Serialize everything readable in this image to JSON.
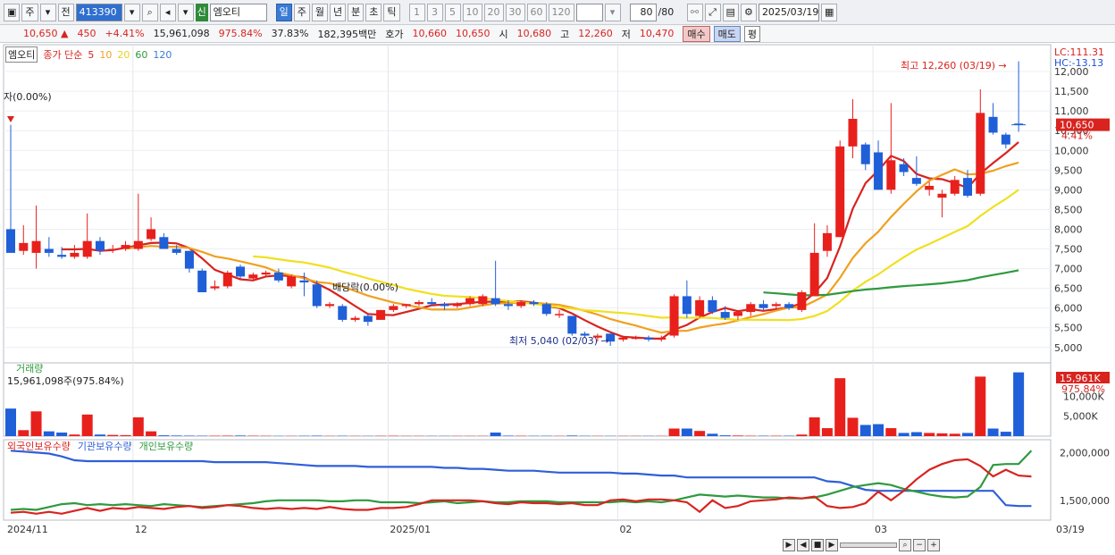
{
  "toolbar": {
    "market": "주",
    "prev_label": "전",
    "stock_code": "413390",
    "new_badge": "신",
    "stock_name": "엠오티",
    "periods": [
      "일",
      "주",
      "월",
      "년",
      "분",
      "초",
      "틱"
    ],
    "active_period": "일",
    "intervals": [
      "1",
      "3",
      "5",
      "10",
      "20",
      "30",
      "60",
      "120"
    ],
    "count_value": "80",
    "count_total": "/80",
    "date_value": "2025/03/19"
  },
  "infobar": {
    "price": "10,650 ▲",
    "change": "450",
    "change_pct": "+4.41%",
    "volume": "15,961,098",
    "volume_ratio": "975.84%",
    "turnover": "37.83%",
    "trade_value": "182,395백만",
    "ask_label": "호가",
    "ask_price": "10,660",
    "bid_price": "10,650",
    "open_label": "시",
    "open_price": "10,680",
    "high_label": "고",
    "high_price": "12,260",
    "low_label": "저",
    "low_price": "10,470",
    "buy_label": "매수",
    "sell_label": "매도",
    "avg_label": "평"
  },
  "legend": {
    "name": "엠오티",
    "series_prefix": "종가 단순",
    "ma_labels": [
      "5",
      "10",
      "20",
      "60",
      "120"
    ],
    "ma_colors": [
      "#d8231f",
      "#f0a020",
      "#f0e020",
      "#2e9a3e",
      "#3a7bd5"
    ]
  },
  "annotations": {
    "ex_right": "자(0.00%)",
    "dividend_drop": "배당락(0.00%)",
    "high_note": "최고 12,260 (03/19) →",
    "low_note": "최저 5,040 (02/03) →",
    "lc": "LC:111.31",
    "hc": "HC:-13.13",
    "current_price_tag": "10,650",
    "current_pct_tag": "4.41%"
  },
  "volume_panel": {
    "title": "거래량",
    "value_label": "15,961,098주(975.84%)",
    "tag_value": "15,961K",
    "tag_pct": "975.84%"
  },
  "holding_panel": {
    "labels": [
      "외국인보유수량",
      "기관보유수량",
      "개인보유수량"
    ],
    "colors": [
      "#d8231f",
      "#2f5fd8",
      "#2e9a3e"
    ]
  },
  "axis": {
    "price_ticks": [
      "12,000",
      "11,500",
      "11,000",
      "10,500",
      "10,000",
      "9,500",
      "9,000",
      "8,500",
      "8,000",
      "7,500",
      "7,000",
      "6,500",
      "6,000",
      "5,500",
      "5,000"
    ],
    "volume_ticks": [
      "10,000K",
      "5,000K"
    ],
    "holding_ticks": [
      "2,000,000",
      "1,500,000"
    ],
    "date_labels": [
      "2024/11",
      "12",
      "2025/01",
      "02",
      "03",
      "03/19"
    ]
  },
  "chart_data": {
    "type": "candlestick",
    "price_range": [
      4700,
      12500
    ],
    "candles": [
      {
        "o": 8000,
        "h": 10650,
        "l": 7400,
        "c": 7400
      },
      {
        "o": 7450,
        "h": 8100,
        "l": 7350,
        "c": 7650
      },
      {
        "o": 7400,
        "h": 8600,
        "l": 7000,
        "c": 7700
      },
      {
        "o": 7500,
        "h": 7800,
        "l": 7300,
        "c": 7400
      },
      {
        "o": 7350,
        "h": 7550,
        "l": 7250,
        "c": 7300
      },
      {
        "o": 7300,
        "h": 7600,
        "l": 7250,
        "c": 7400
      },
      {
        "o": 7300,
        "h": 8400,
        "l": 7250,
        "c": 7700
      },
      {
        "o": 7700,
        "h": 7800,
        "l": 7350,
        "c": 7450
      },
      {
        "o": 7500,
        "h": 7600,
        "l": 7400,
        "c": 7500
      },
      {
        "o": 7500,
        "h": 7700,
        "l": 7450,
        "c": 7600
      },
      {
        "o": 7500,
        "h": 8900,
        "l": 7450,
        "c": 7700
      },
      {
        "o": 7750,
        "h": 8300,
        "l": 7700,
        "c": 8000
      },
      {
        "o": 7800,
        "h": 7900,
        "l": 7500,
        "c": 7500
      },
      {
        "o": 7500,
        "h": 7600,
        "l": 7350,
        "c": 7400
      },
      {
        "o": 7450,
        "h": 7450,
        "l": 6900,
        "c": 7000
      },
      {
        "o": 6950,
        "h": 7000,
        "l": 6400,
        "c": 6400
      },
      {
        "o": 6500,
        "h": 6700,
        "l": 6450,
        "c": 6550
      },
      {
        "o": 6550,
        "h": 6950,
        "l": 6500,
        "c": 6900
      },
      {
        "o": 7050,
        "h": 7100,
        "l": 6750,
        "c": 6800
      },
      {
        "o": 6750,
        "h": 6900,
        "l": 6700,
        "c": 6850
      },
      {
        "o": 6850,
        "h": 6950,
        "l": 6800,
        "c": 6900
      },
      {
        "o": 6900,
        "h": 7000,
        "l": 6650,
        "c": 6700
      },
      {
        "o": 6550,
        "h": 6850,
        "l": 6500,
        "c": 6800
      },
      {
        "o": 6700,
        "h": 6900,
        "l": 6300,
        "c": 6650
      },
      {
        "o": 6600,
        "h": 6700,
        "l": 6000,
        "c": 6050
      },
      {
        "o": 6050,
        "h": 6150,
        "l": 6000,
        "c": 6100
      },
      {
        "o": 6050,
        "h": 6100,
        "l": 5650,
        "c": 5700
      },
      {
        "o": 5700,
        "h": 5800,
        "l": 5650,
        "c": 5750
      },
      {
        "o": 5800,
        "h": 5850,
        "l": 5550,
        "c": 5650
      },
      {
        "o": 5700,
        "h": 5950,
        "l": 5700,
        "c": 5950
      },
      {
        "o": 5950,
        "h": 6100,
        "l": 5900,
        "c": 6050
      },
      {
        "o": 6050,
        "h": 6100,
        "l": 6000,
        "c": 6100
      },
      {
        "o": 6100,
        "h": 6200,
        "l": 6050,
        "c": 6150
      },
      {
        "o": 6150,
        "h": 6250,
        "l": 6050,
        "c": 6100
      },
      {
        "o": 6100,
        "h": 6150,
        "l": 5950,
        "c": 6050
      },
      {
        "o": 6050,
        "h": 6150,
        "l": 6000,
        "c": 6100
      },
      {
        "o": 6100,
        "h": 6300,
        "l": 6050,
        "c": 6250
      },
      {
        "o": 6100,
        "h": 6350,
        "l": 6050,
        "c": 6300
      },
      {
        "o": 6250,
        "h": 7200,
        "l": 6050,
        "c": 6100
      },
      {
        "o": 6100,
        "h": 6200,
        "l": 5950,
        "c": 6050
      },
      {
        "o": 6050,
        "h": 6200,
        "l": 6000,
        "c": 6150
      },
      {
        "o": 6150,
        "h": 6200,
        "l": 6050,
        "c": 6100
      },
      {
        "o": 6100,
        "h": 6150,
        "l": 5800,
        "c": 5850
      },
      {
        "o": 5850,
        "h": 5950,
        "l": 5750,
        "c": 5850
      },
      {
        "o": 5800,
        "h": 5800,
        "l": 5300,
        "c": 5350
      },
      {
        "o": 5350,
        "h": 5400,
        "l": 5250,
        "c": 5300
      },
      {
        "o": 5250,
        "h": 5350,
        "l": 5150,
        "c": 5300
      },
      {
        "o": 5350,
        "h": 5350,
        "l": 5040,
        "c": 5150
      },
      {
        "o": 5200,
        "h": 5300,
        "l": 5150,
        "c": 5250
      },
      {
        "o": 5250,
        "h": 5300,
        "l": 5200,
        "c": 5250
      },
      {
        "o": 5250,
        "h": 5300,
        "l": 5150,
        "c": 5200
      },
      {
        "o": 5200,
        "h": 5300,
        "l": 5150,
        "c": 5250
      },
      {
        "o": 5300,
        "h": 6350,
        "l": 5250,
        "c": 6300
      },
      {
        "o": 6300,
        "h": 6700,
        "l": 5750,
        "c": 5850
      },
      {
        "o": 5800,
        "h": 6300,
        "l": 5750,
        "c": 6200
      },
      {
        "o": 6200,
        "h": 6300,
        "l": 5850,
        "c": 5900
      },
      {
        "o": 5900,
        "h": 6050,
        "l": 5700,
        "c": 5750
      },
      {
        "o": 5800,
        "h": 5950,
        "l": 5700,
        "c": 5900
      },
      {
        "o": 5900,
        "h": 6150,
        "l": 5800,
        "c": 6100
      },
      {
        "o": 6100,
        "h": 6200,
        "l": 5950,
        "c": 6000
      },
      {
        "o": 6050,
        "h": 6150,
        "l": 5950,
        "c": 6100
      },
      {
        "o": 6100,
        "h": 6150,
        "l": 5950,
        "c": 6000
      },
      {
        "o": 5950,
        "h": 6450,
        "l": 5900,
        "c": 6400
      },
      {
        "o": 6300,
        "h": 8150,
        "l": 6300,
        "c": 7400
      },
      {
        "o": 7450,
        "h": 8100,
        "l": 7300,
        "c": 7900
      },
      {
        "o": 7800,
        "h": 10250,
        "l": 7800,
        "c": 10100
      },
      {
        "o": 10100,
        "h": 11300,
        "l": 9800,
        "c": 10800
      },
      {
        "o": 10150,
        "h": 10200,
        "l": 9500,
        "c": 9650
      },
      {
        "o": 9950,
        "h": 10250,
        "l": 9000,
        "c": 9000
      },
      {
        "o": 9000,
        "h": 11200,
        "l": 8900,
        "c": 9750
      },
      {
        "o": 9650,
        "h": 9800,
        "l": 9350,
        "c": 9450
      },
      {
        "o": 9300,
        "h": 9850,
        "l": 9100,
        "c": 9150
      },
      {
        "o": 9000,
        "h": 9200,
        "l": 8850,
        "c": 9100
      },
      {
        "o": 8800,
        "h": 9000,
        "l": 8300,
        "c": 8900
      },
      {
        "o": 8900,
        "h": 9350,
        "l": 8850,
        "c": 9250
      },
      {
        "o": 9300,
        "h": 9500,
        "l": 8800,
        "c": 8850
      },
      {
        "o": 8900,
        "h": 11550,
        "l": 8850,
        "c": 10950
      },
      {
        "o": 10850,
        "h": 11200,
        "l": 10400,
        "c": 10450
      },
      {
        "o": 10400,
        "h": 10450,
        "l": 10050,
        "c": 10150
      },
      {
        "o": 10680,
        "h": 12260,
        "l": 10470,
        "c": 10650
      }
    ],
    "volume_k": [
      6900,
      1500,
      6200,
      1200,
      900,
      400,
      5400,
      400,
      300,
      250,
      4700,
      1200,
      200,
      150,
      120,
      100,
      100,
      120,
      150,
      100,
      80,
      60,
      60,
      90,
      120,
      60,
      90,
      60,
      60,
      80,
      90,
      60,
      60,
      60,
      60,
      60,
      60,
      60,
      900,
      120,
      90,
      80,
      80,
      60,
      150,
      80,
      60,
      60,
      60,
      60,
      60,
      60,
      1900,
      1900,
      1300,
      600,
      200,
      150,
      100,
      100,
      100,
      100,
      400,
      4700,
      2000,
      14500,
      4600,
      2800,
      3000,
      2000,
      800,
      1000,
      800,
      700,
      600,
      800,
      14900,
      1900,
      1100,
      15961
    ],
    "holding_foreign": [
      1370000,
      1380000,
      1360000,
      1380000,
      1360000,
      1390000,
      1420000,
      1390000,
      1420000,
      1410000,
      1430000,
      1420000,
      1410000,
      1430000,
      1440000,
      1420000,
      1430000,
      1450000,
      1440000,
      1420000,
      1410000,
      1420000,
      1410000,
      1420000,
      1410000,
      1430000,
      1410000,
      1400000,
      1400000,
      1420000,
      1420000,
      1430000,
      1460000,
      1500000,
      1500000,
      1500000,
      1500000,
      1490000,
      1470000,
      1460000,
      1480000,
      1470000,
      1470000,
      1460000,
      1470000,
      1450000,
      1450000,
      1500000,
      1510000,
      1490000,
      1510000,
      1510000,
      1500000,
      1480000,
      1380000,
      1500000,
      1420000,
      1440000,
      1490000,
      1500000,
      1510000,
      1530000,
      1520000,
      1540000,
      1440000,
      1420000,
      1430000,
      1470000,
      1590000,
      1500000,
      1600000,
      1720000,
      1820000,
      1880000,
      1920000,
      1930000,
      1860000,
      1750000,
      1820000,
      1760000,
      1750000
    ],
    "holding_inst": [
      2020000,
      2010000,
      2000000,
      1990000,
      1960000,
      1920000,
      1910000,
      1910000,
      1910000,
      1910000,
      1910000,
      1910000,
      1910000,
      1910000,
      1910000,
      1910000,
      1900000,
      1900000,
      1900000,
      1900000,
      1900000,
      1890000,
      1880000,
      1870000,
      1860000,
      1860000,
      1860000,
      1860000,
      1850000,
      1850000,
      1850000,
      1850000,
      1850000,
      1850000,
      1840000,
      1840000,
      1830000,
      1830000,
      1820000,
      1810000,
      1810000,
      1810000,
      1800000,
      1790000,
      1790000,
      1790000,
      1790000,
      1790000,
      1780000,
      1780000,
      1770000,
      1760000,
      1760000,
      1740000,
      1740000,
      1740000,
      1740000,
      1740000,
      1740000,
      1740000,
      1740000,
      1740000,
      1740000,
      1740000,
      1700000,
      1690000,
      1650000,
      1610000,
      1600000,
      1600000,
      1600000,
      1600000,
      1600000,
      1600000,
      1600000,
      1600000,
      1600000,
      1600000,
      1450000,
      1440000,
      1440000
    ],
    "holding_indiv": [
      1400000,
      1410000,
      1400000,
      1430000,
      1460000,
      1470000,
      1450000,
      1460000,
      1450000,
      1460000,
      1450000,
      1440000,
      1460000,
      1450000,
      1440000,
      1430000,
      1440000,
      1450000,
      1460000,
      1470000,
      1490000,
      1500000,
      1500000,
      1500000,
      1500000,
      1490000,
      1490000,
      1500000,
      1500000,
      1480000,
      1480000,
      1480000,
      1470000,
      1480000,
      1490000,
      1470000,
      1480000,
      1490000,
      1480000,
      1480000,
      1490000,
      1490000,
      1490000,
      1480000,
      1480000,
      1480000,
      1480000,
      1480000,
      1490000,
      1480000,
      1490000,
      1480000,
      1500000,
      1530000,
      1560000,
      1550000,
      1540000,
      1550000,
      1540000,
      1530000,
      1530000,
      1520000,
      1520000,
      1530000,
      1560000,
      1600000,
      1640000,
      1660000,
      1680000,
      1660000,
      1620000,
      1590000,
      1560000,
      1540000,
      1530000,
      1540000,
      1640000,
      1870000,
      1880000,
      1880000,
      2020000
    ]
  }
}
